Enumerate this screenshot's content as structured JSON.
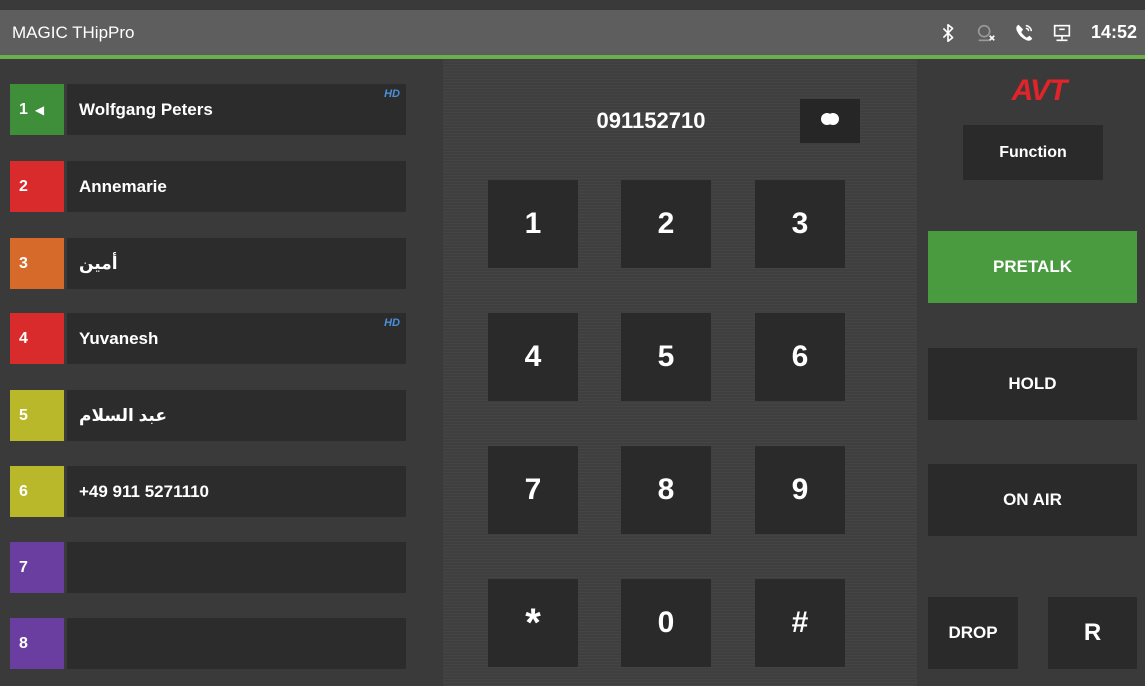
{
  "header": {
    "title": "MAGIC THipPro",
    "clock": "14:52",
    "status_icons": [
      "bluetooth-icon",
      "no-registration-icon",
      "phone-ringing-icon",
      "network-icon"
    ]
  },
  "colors": {
    "accent": "#6ab04c",
    "line_1": "#3e8e3a",
    "line_2": "#d92b2b",
    "line_3": "#d66a2a",
    "line_4": "#d92b2b",
    "line_5": "#b8b82a",
    "line_6": "#b8b82a",
    "line_7": "#6a3ea0",
    "line_8": "#6a3ea0",
    "hd_badge": "#4a90d9",
    "pretalk_active": "#4a9a3f",
    "brand": "#e0242a"
  },
  "lines": [
    {
      "number": "1",
      "name": "Wolfgang Peters",
      "hd": "HD",
      "active_arrow": "◀"
    },
    {
      "number": "2",
      "name": "Annemarie"
    },
    {
      "number": "3",
      "name": "أمين"
    },
    {
      "number": "4",
      "name": "Yuvanesh",
      "hd": "HD"
    },
    {
      "number": "5",
      "name": "عبد السلام"
    },
    {
      "number": "6",
      "name": "+49 911 5271110"
    },
    {
      "number": "7",
      "name": ""
    },
    {
      "number": "8",
      "name": ""
    }
  ],
  "dialpad": {
    "number": "091152710",
    "keys": [
      "1",
      "2",
      "3",
      "4",
      "5",
      "6",
      "7",
      "8",
      "9",
      "*",
      "0",
      "#"
    ]
  },
  "controls": {
    "brand": "AVT",
    "function": "Function",
    "pretalk": "PRETALK",
    "hold": "HOLD",
    "on_air": "ON AIR",
    "drop": "DROP",
    "r": "R"
  }
}
